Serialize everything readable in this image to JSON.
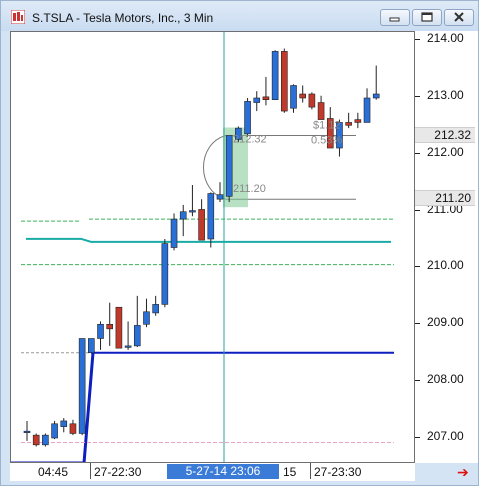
{
  "window": {
    "title": "S.TSLA - Tesla Motors, Inc., 3 Min",
    "buttons": {
      "minimize": "minimize",
      "maximize": "maximize",
      "close": "close"
    }
  },
  "price_axis": {
    "labels": [
      "214.00",
      "213.00",
      "212.00",
      "211.00",
      "210.00",
      "209.00",
      "208.00",
      "207.00"
    ],
    "marker_high": "212.32",
    "marker_low": "211.20"
  },
  "time_axis": {
    "labels": {
      "a": "04:45",
      "b": "27-22:30",
      "cursor": "5-27-14 23:06",
      "c": "15",
      "d": "27-23:30"
    }
  },
  "measure": {
    "high": "212.32",
    "low": "211.20",
    "change": "$1.12",
    "change_pct": "0.53%"
  },
  "colors": {
    "up": "#2a6fd6",
    "down": "#c0392b",
    "ma_teal": "#1aaba6",
    "ma_green": "#3cb45a",
    "dark_blue": "#0d1fbf",
    "pink": "#e8a3c6",
    "crosshair": "#2aa59e",
    "highlight": "#7ec992"
  },
  "chart_data": {
    "type": "candlestick",
    "timeframe": "3 Min",
    "symbol": "S.TSLA",
    "ylim": [
      206.5,
      214.2
    ],
    "candles": [
      {
        "o": 207.12,
        "h": 207.3,
        "l": 206.95,
        "c": 207.12
      },
      {
        "o": 207.05,
        "h": 207.08,
        "l": 206.85,
        "c": 206.88
      },
      {
        "o": 206.88,
        "h": 207.08,
        "l": 206.85,
        "c": 207.05
      },
      {
        "o": 207.0,
        "h": 207.3,
        "l": 206.98,
        "c": 207.25
      },
      {
        "o": 207.2,
        "h": 207.35,
        "l": 207.1,
        "c": 207.3
      },
      {
        "o": 207.25,
        "h": 207.32,
        "l": 207.05,
        "c": 207.08
      },
      {
        "o": 207.08,
        "h": 208.55,
        "l": 207.05,
        "c": 208.75
      },
      {
        "o": 208.5,
        "h": 208.75,
        "l": 208.5,
        "c": 208.75
      },
      {
        "o": 208.75,
        "h": 209.05,
        "l": 208.55,
        "c": 209.0
      },
      {
        "o": 209.0,
        "h": 209.38,
        "l": 208.62,
        "c": 208.92
      },
      {
        "o": 209.3,
        "h": 209.3,
        "l": 208.6,
        "c": 208.58
      },
      {
        "o": 208.62,
        "h": 209.05,
        "l": 208.55,
        "c": 208.62
      },
      {
        "o": 208.62,
        "h": 209.5,
        "l": 208.6,
        "c": 208.98
      },
      {
        "o": 209.0,
        "h": 209.45,
        "l": 208.95,
        "c": 209.22
      },
      {
        "o": 209.2,
        "h": 209.5,
        "l": 209.15,
        "c": 209.35
      },
      {
        "o": 209.35,
        "h": 210.5,
        "l": 209.3,
        "c": 210.42
      },
      {
        "o": 210.35,
        "h": 210.95,
        "l": 210.3,
        "c": 210.85
      },
      {
        "o": 210.85,
        "h": 211.1,
        "l": 210.55,
        "c": 210.98
      },
      {
        "o": 210.98,
        "h": 211.45,
        "l": 210.9,
        "c": 211.0
      },
      {
        "o": 211.02,
        "h": 211.2,
        "l": 210.55,
        "c": 210.48
      },
      {
        "o": 210.5,
        "h": 211.32,
        "l": 210.35,
        "c": 211.3
      },
      {
        "o": 211.2,
        "h": 211.5,
        "l": 211.15,
        "c": 211.28
      },
      {
        "o": 211.25,
        "h": 212.1,
        "l": 211.15,
        "c": 212.32
      },
      {
        "o": 212.25,
        "h": 212.48,
        "l": 212.2,
        "c": 212.45
      },
      {
        "o": 212.35,
        "h": 212.98,
        "l": 212.3,
        "c": 212.92
      },
      {
        "o": 212.9,
        "h": 213.1,
        "l": 212.75,
        "c": 212.98
      },
      {
        "o": 213.0,
        "h": 213.35,
        "l": 212.85,
        "c": 212.95
      },
      {
        "o": 212.95,
        "h": 213.82,
        "l": 212.95,
        "c": 213.8
      },
      {
        "o": 213.8,
        "h": 213.85,
        "l": 212.72,
        "c": 212.75
      },
      {
        "o": 212.8,
        "h": 213.22,
        "l": 212.72,
        "c": 213.2
      },
      {
        "o": 213.05,
        "h": 213.2,
        "l": 212.9,
        "c": 212.98
      },
      {
        "o": 213.05,
        "h": 213.08,
        "l": 212.78,
        "c": 212.82
      },
      {
        "o": 212.9,
        "h": 213.02,
        "l": 212.78,
        "c": 212.6
      },
      {
        "o": 212.62,
        "h": 212.82,
        "l": 212.1,
        "c": 212.1
      },
      {
        "o": 212.1,
        "h": 212.6,
        "l": 211.95,
        "c": 212.55
      },
      {
        "o": 212.55,
        "h": 212.72,
        "l": 212.45,
        "c": 212.5
      },
      {
        "o": 212.6,
        "h": 212.72,
        "l": 212.45,
        "c": 212.55
      },
      {
        "o": 212.55,
        "h": 213.15,
        "l": 212.55,
        "c": 212.98
      },
      {
        "o": 212.98,
        "h": 213.55,
        "l": 212.95,
        "c": 213.05
      }
    ],
    "lines": {
      "upper_band": 210.85,
      "middle": 210.45,
      "lower_band": 210.05,
      "dark_blue_level": 208.5,
      "gray_level": 208.5,
      "pink_level": 206.92
    },
    "crosshair_time": "5-27-14 23:06"
  }
}
